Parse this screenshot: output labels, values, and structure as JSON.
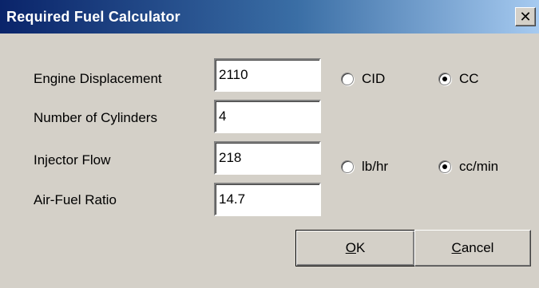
{
  "window": {
    "title": "Required Fuel Calculator",
    "close_glyph": "✕"
  },
  "fields": {
    "engine_displacement": {
      "label": "Engine Displacement",
      "value": "2110"
    },
    "num_cylinders": {
      "label": "Number of Cylinders",
      "value": "4"
    },
    "injector_flow": {
      "label": "Injector Flow",
      "value": "218"
    },
    "air_fuel_ratio": {
      "label": "Air-Fuel Ratio",
      "value": "14.7"
    }
  },
  "displacement_units": {
    "cid": {
      "label": "CID",
      "checked": false
    },
    "cc": {
      "label": "CC",
      "checked": true
    }
  },
  "flow_units": {
    "lb_hr": {
      "label": "lb/hr",
      "checked": false
    },
    "cc_min": {
      "label": "cc/min",
      "checked": true
    }
  },
  "buttons": {
    "ok": {
      "mnemonic": "O",
      "rest": "K"
    },
    "cancel": {
      "mnemonic": "C",
      "rest": "ancel"
    }
  },
  "icons": {
    "close": "close-icon",
    "radio": "radio-button-icon"
  },
  "colors": {
    "titlebar_start": "#0a246a",
    "titlebar_end": "#a6caf0",
    "dialog_bg": "#d4d0c8"
  }
}
